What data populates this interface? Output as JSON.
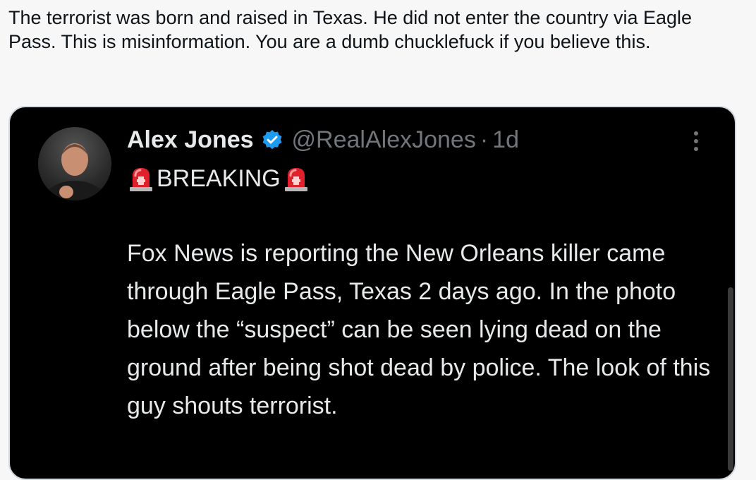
{
  "comment": {
    "text": "The terrorist was born and raised in Texas. He did not enter the country via Eagle Pass. This is misinformation. You are a dumb chucklefuck if you believe this."
  },
  "quoted_post": {
    "display_name": "Alex Jones",
    "handle": "@RealAlexJones",
    "separator": "·",
    "timestamp": "1d",
    "verified_icon": "verified-badge-icon",
    "more_icon": "more-options-icon",
    "headline": "BREAKING",
    "headline_icon": "police-siren-icon",
    "body": "Fox News is reporting the New Orleans killer came through Eagle Pass, Texas 2 days ago. In the photo below the “suspect” can be seen lying dead on the ground after being shot dead by police. The look of this guy shouts terrorist."
  },
  "colors": {
    "page_background": "#f7f7f7",
    "card_background": "#000000",
    "primary_text_dark": "#e7e9ea",
    "secondary_text": "#71767b",
    "verified_blue": "#1d9bf0",
    "siren_red": "#e0202a"
  }
}
